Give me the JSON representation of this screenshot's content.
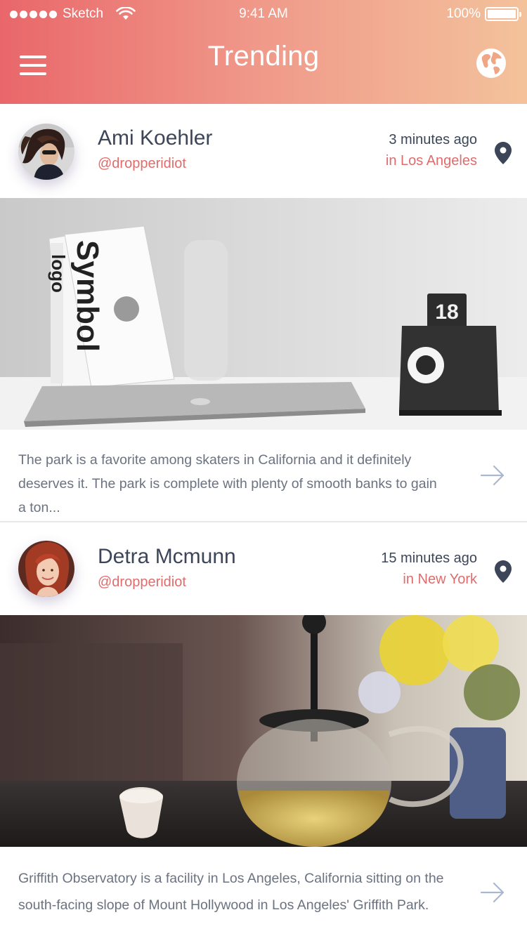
{
  "status_bar": {
    "carrier": "Sketch",
    "time": "9:41 AM",
    "battery": "100%"
  },
  "header": {
    "title": "Trending",
    "menu_icon": "hamburger-icon",
    "globe_icon": "globe-icon"
  },
  "posts": [
    {
      "name": "Ami Koehler",
      "handle": "@dropperidiot",
      "time": "3 minutes ago",
      "location": "in Los Angeles",
      "text": "The park is a favorite among skaters in California and it definitely deserves it. The park is complete with plenty of smooth banks to gain a ton...",
      "image_book_spine": "Symbol",
      "image_book_spine_2": "logo",
      "image_calendar_number": "18",
      "location_icon": "map-pin-icon",
      "arrow_icon": "arrow-right-icon"
    },
    {
      "name": "Detra Mcmunn",
      "handle": "@dropperidiot",
      "time": "15 minutes ago",
      "location": "in New York",
      "text": "Griffith Observatory is a facility in Los Angeles, California sitting on the south-facing slope of Mount Hollywood in Los Angeles' Griffith Park.",
      "location_icon": "map-pin-icon",
      "arrow_icon": "arrow-right-icon"
    }
  ],
  "colors": {
    "gradient_start": "#e9676a",
    "gradient_end": "#f3c29b",
    "accent": "#e06c6c",
    "text_dark": "#3c4658",
    "text_body": "#6b7280"
  }
}
